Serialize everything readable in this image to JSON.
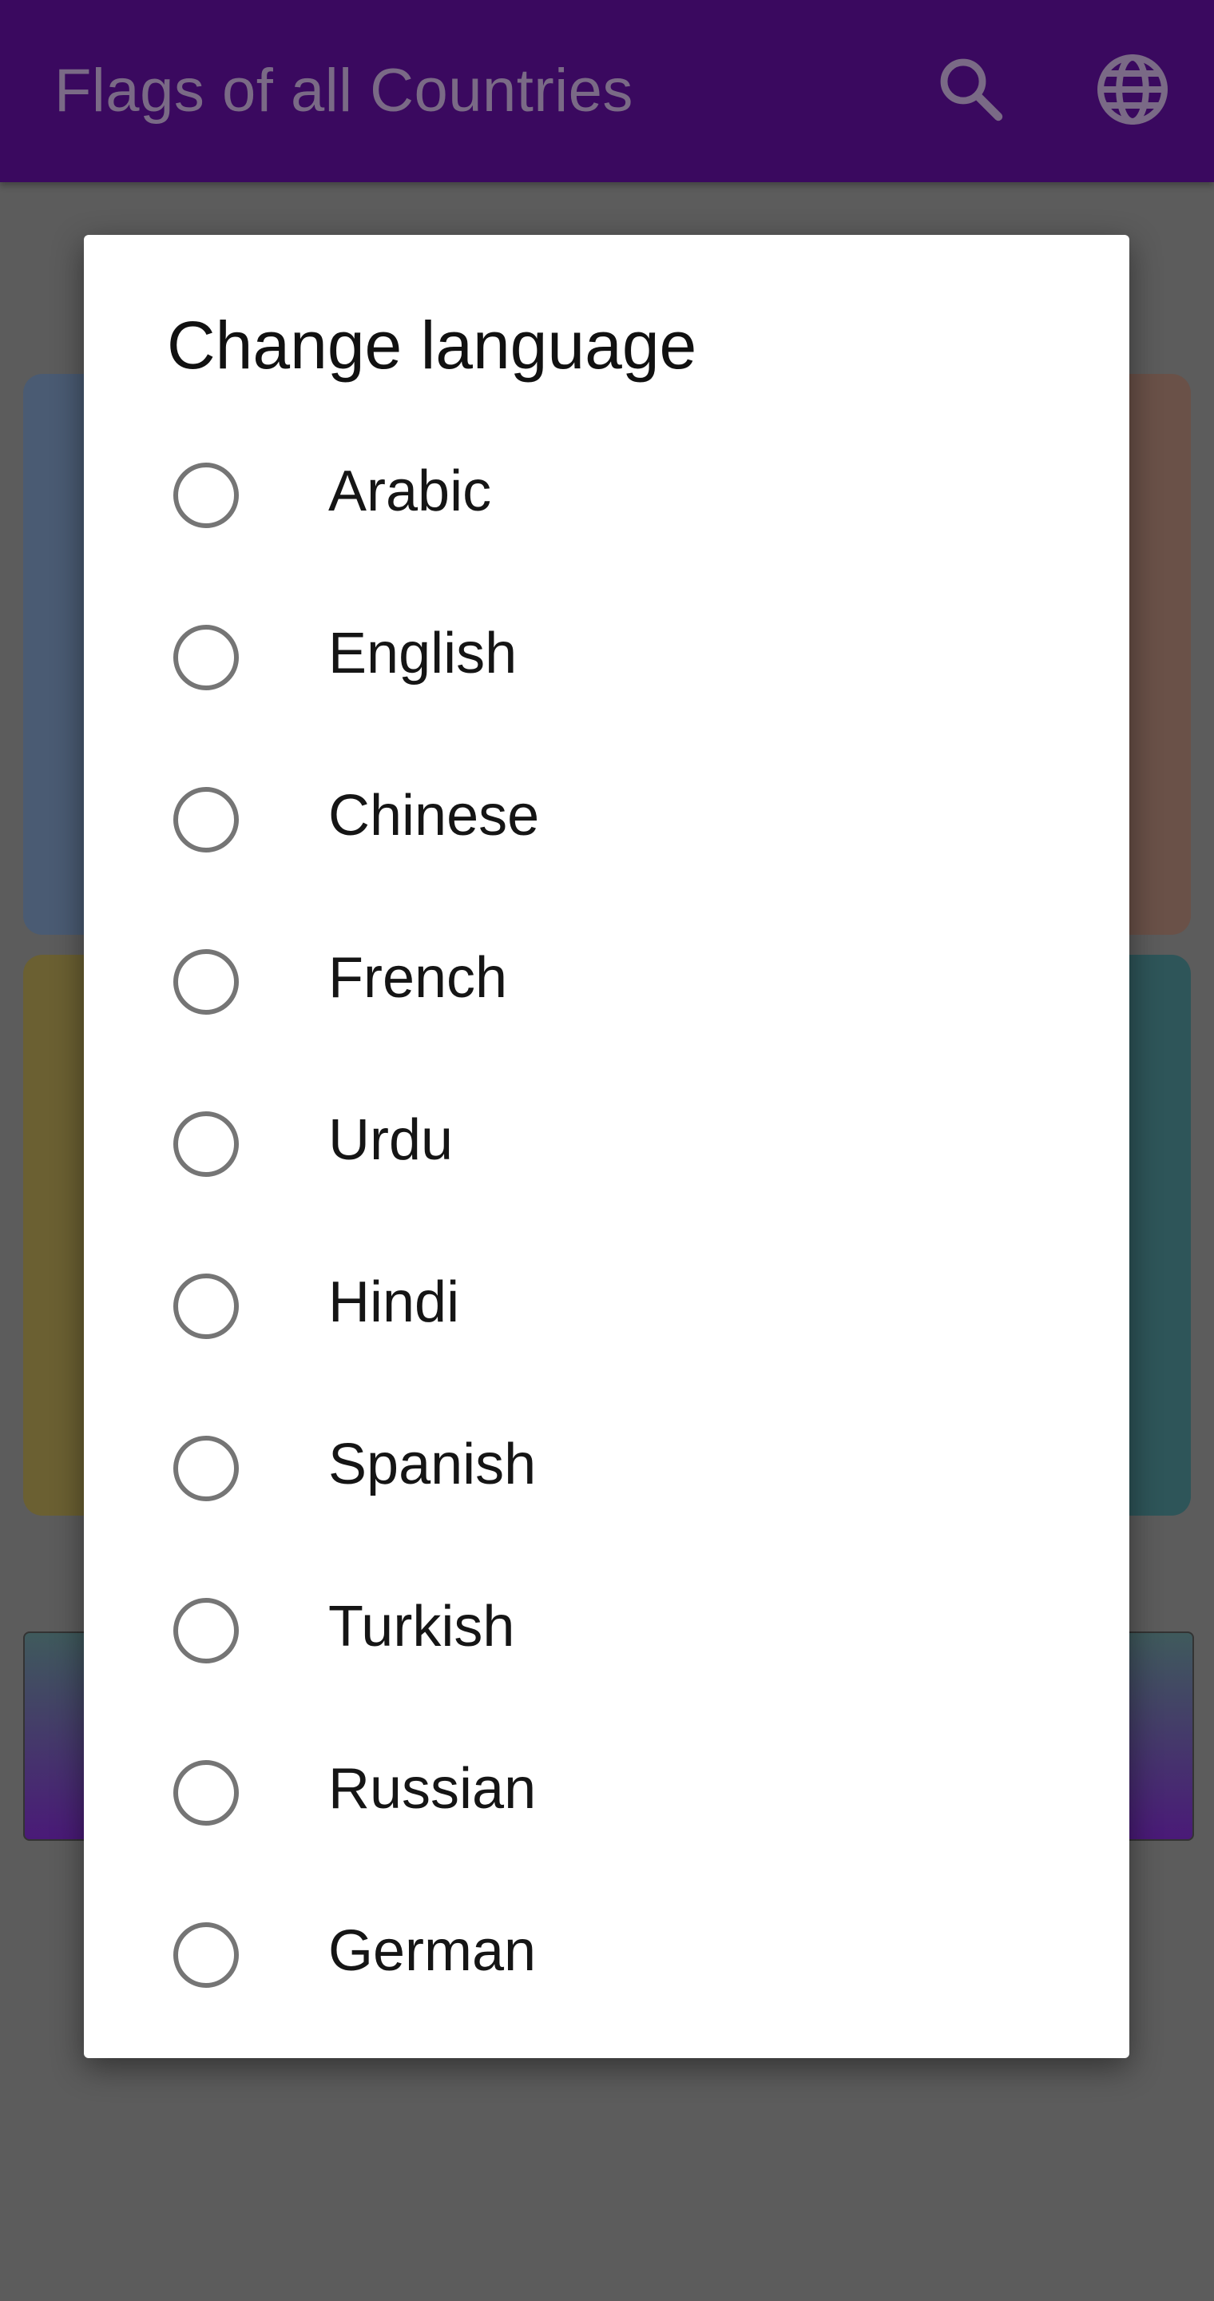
{
  "appbar": {
    "title": "Flags of all Countries",
    "icons": [
      "search-icon",
      "globe-icon"
    ],
    "color": "#3a095f"
  },
  "dialog": {
    "title": "Change language",
    "options": [
      {
        "label": "Arabic",
        "selected": false
      },
      {
        "label": "English",
        "selected": false
      },
      {
        "label": "Chinese",
        "selected": false
      },
      {
        "label": "French",
        "selected": false
      },
      {
        "label": "Urdu",
        "selected": false
      },
      {
        "label": "Hindi",
        "selected": false
      },
      {
        "label": "Spanish",
        "selected": false
      },
      {
        "label": "Turkish",
        "selected": false
      },
      {
        "label": "Russian",
        "selected": false
      },
      {
        "label": "German",
        "selected": false
      }
    ]
  }
}
